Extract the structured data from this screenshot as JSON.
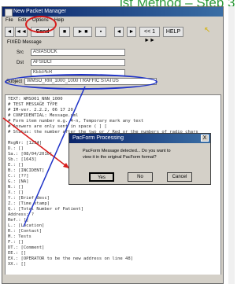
{
  "banner": {
    "text": "ist Method – Step 3",
    "color": "#2e9a3a"
  },
  "window": {
    "title": "New Packet Manager",
    "menu": [
      "File",
      "Edit",
      "Options",
      "Help"
    ],
    "toolbar": [
      {
        "label": "◄",
        "id": "tb-1"
      },
      {
        "label": "◄◄",
        "id": "tb-2"
      },
      {
        "label": "Send",
        "id": "tb-send"
      },
      {
        "label": "■",
        "id": "tb-4"
      },
      {
        "label": "► ■",
        "id": "tb-5"
      },
      {
        "label": "▪",
        "id": "tb-6"
      },
      {
        "label": "◄",
        "id": "tb-7"
      },
      {
        "label": "►",
        "id": "tb-8"
      },
      {
        "label": "<< 1 ►►",
        "id": "tb-9"
      },
      {
        "label": "HELP",
        "id": "tb-help"
      }
    ],
    "fields_label": "FIXED Message",
    "fields": [
      {
        "label": "Src",
        "value": "ASIASOCK"
      },
      {
        "label": "Dst",
        "value": "AFSIDCI"
      },
      {
        "label": "",
        "value": "KEEPER"
      },
      {
        "label": "Subject",
        "value": "WMSO_RM_1000_1000 TRAFFIC STATUS"
      }
    ],
    "lines": [
      "TEXT: WMSO01_NNN_1000",
      "# TEST MESSAGE TYPE",
      "# IM-ver. 2.2.2, 06 17 20",
      "# CONFIDENTIAL: Message.xml",
      "# Form item number e.g. 4-n, Temporary mark any text",
      "# Answers are only sent in space ( ] [",
      "# Status: the number after the two or / Red or the numbers of radio chars",
      "",
      "MsgNr: [1234]",
      "D.: []",
      "Sa.: [08/04/2010]",
      "Sb.: [1643]",
      "E.: []",
      "B.: [INCIDENT]",
      "C.: [??]",
      "G.: [NA]",
      "N.: []",
      "X.: []",
      "Y.: [Brief desc]",
      "Z.: [Time stamp]",
      "Q.: [Total Number of Patient]",
      "Address: ?",
      "Ref.: []",
      "L.: [Location]",
      "R.: [Contact]",
      "M.: Tests",
      "F.: []",
      "DT.: [Comment]",
      "EE.: []",
      "EX.: [OPERATOR to be the new address on line 48]",
      "XX.: []"
    ],
    "dialog": {
      "title": "PacForm Processing",
      "close_label": "X",
      "message_line1": "PacForm Message detected... Do you want to",
      "message_line2": "view it in the original PacForm format?",
      "buttons": [
        "Yes",
        "No",
        "Cancel"
      ]
    }
  },
  "colors": {
    "highlight_red": "#d81c1c",
    "highlight_blue": "#1f33c8",
    "title_bar": "#0a246a"
  }
}
